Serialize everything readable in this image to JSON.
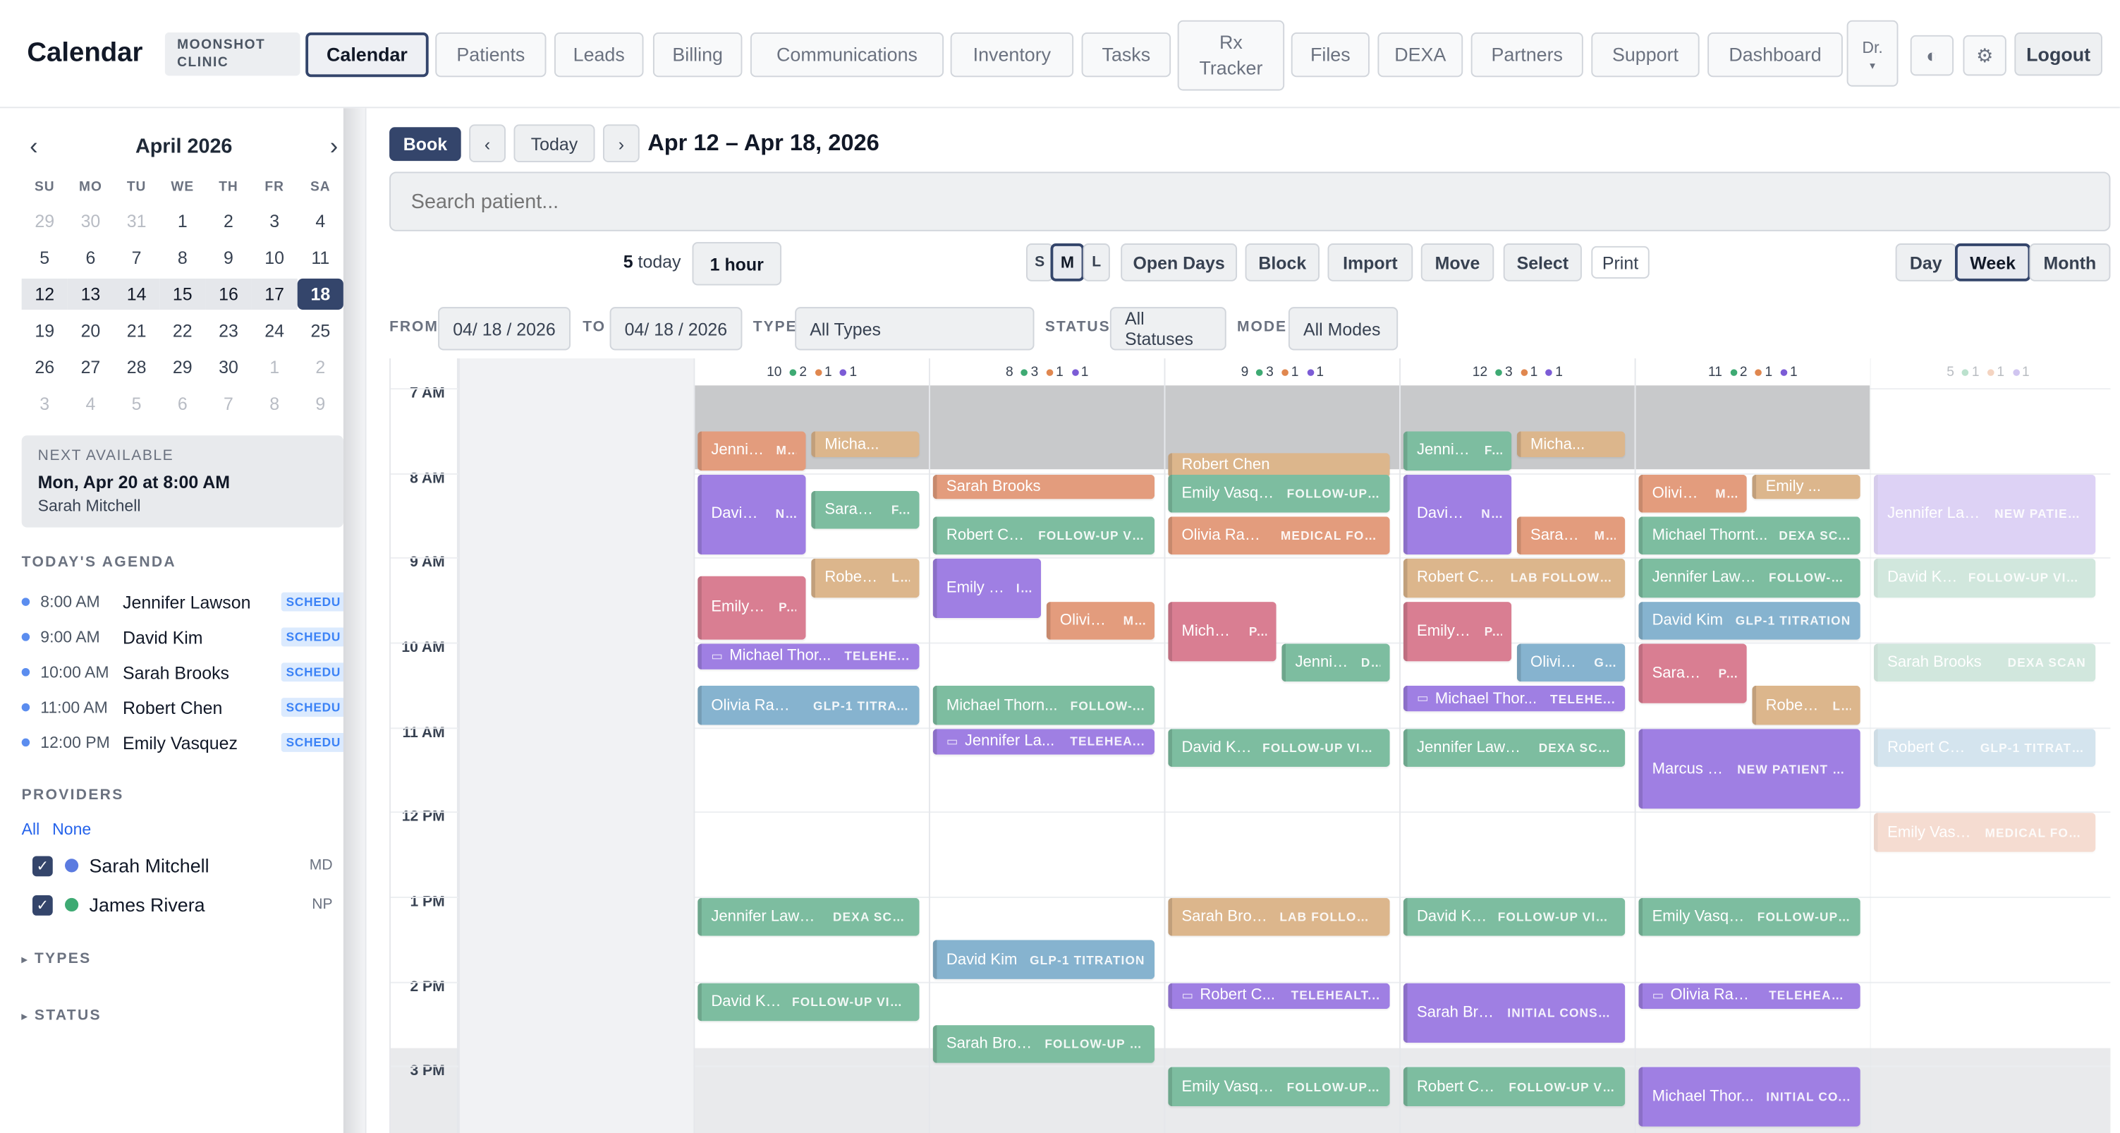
{
  "header": {
    "title": "Calendar",
    "clinic": "MOONSHOT CLINIC",
    "nav": [
      "Calendar",
      "Patients",
      "Leads",
      "Billing",
      "Communications",
      "Inventory",
      "Tasks",
      "Rx Tracker",
      "Files",
      "DEXA",
      "Partners",
      "Support",
      "Dashboard",
      "Dr."
    ],
    "logout": "Logout",
    "active_tab": "Calendar"
  },
  "mini_calendar": {
    "month_label": "April 2026",
    "prev": "‹",
    "next": "›",
    "dow": [
      "SU",
      "MO",
      "TU",
      "WE",
      "TH",
      "FR",
      "SA"
    ],
    "days": [
      "29",
      "30",
      "31",
      "1",
      "2",
      "3",
      "4",
      "5",
      "6",
      "7",
      "8",
      "9",
      "10",
      "11",
      "12",
      "13",
      "14",
      "15",
      "16",
      "17",
      "18",
      "19",
      "20",
      "21",
      "22",
      "23",
      "24",
      "25",
      "26",
      "27",
      "28",
      "29",
      "30",
      "1",
      "2",
      "3",
      "4",
      "5",
      "6",
      "7",
      "8",
      "9"
    ],
    "selected": "18"
  },
  "next_available": {
    "label": "NEXT AVAILABLE",
    "when": "Mon, Apr 20 at 8:00 AM",
    "provider": "Sarah Mitchell"
  },
  "agenda": {
    "label": "TODAY'S AGENDA",
    "items": [
      {
        "time": "8:00 AM",
        "name": "Jennifer Lawson",
        "status": "SCHEDU"
      },
      {
        "time": "9:00 AM",
        "name": "David Kim",
        "status": "SCHEDU"
      },
      {
        "time": "10:00 AM",
        "name": "Sarah Brooks",
        "status": "SCHEDU"
      },
      {
        "time": "11:00 AM",
        "name": "Robert Chen",
        "status": "SCHEDU"
      },
      {
        "time": "12:00 PM",
        "name": "Emily Vasquez",
        "status": "SCHEDU"
      }
    ]
  },
  "providers": {
    "label": "PROVIDERS",
    "all": "All",
    "none": "None",
    "items": [
      {
        "name": "Sarah Mitchell",
        "cred": "MD",
        "color": "#5b7be0"
      },
      {
        "name": "James Rivera",
        "cred": "NP",
        "color": "#3eaa73"
      }
    ]
  },
  "collapsibles": {
    "types": "TYPES",
    "status": "STATUS",
    "caret": "▸"
  },
  "toolbar": {
    "book": "Book",
    "prev": "‹",
    "today": "Today",
    "next": "›",
    "range": "Apr 12 – Apr 18, 2026",
    "search_placeholder": "Search patient...",
    "today_count": "5",
    "today_suffix": " today",
    "slot": "1 hour",
    "sizes": [
      "S",
      "M",
      "L"
    ],
    "actions": [
      "Open Days",
      "Block",
      "Import",
      "Move",
      "Select"
    ],
    "print": "Print",
    "views": [
      "Day",
      "Week",
      "Month"
    ],
    "active_view": "Week"
  },
  "filters": {
    "from_label": "FROM",
    "from": "04/ 18 / 2026",
    "to_label": "TO",
    "to": "04/ 18 / 2026",
    "type_label": "TYPE",
    "type": "All Types",
    "status_label": "STATUS",
    "status": "All Statuses",
    "mode_label": "MODE",
    "mode": "All Modes"
  },
  "colors": {
    "green": "#7dbda0",
    "blue": "#86b3cf",
    "orange": "#e39c7d",
    "purple": "#9f7fe3",
    "tan": "#dcb68c",
    "pink": "#d97e92",
    "primary": "#34456b"
  },
  "hours": [
    "7 AM",
    "8 AM",
    "9 AM",
    "10 AM",
    "11 AM",
    "12 PM",
    "1 PM",
    "2 PM",
    "3 PM"
  ],
  "columns": [
    {
      "counts": [
        "10",
        "2",
        "1",
        "1"
      ]
    },
    {
      "counts": [
        "8",
        "3",
        "1",
        "1"
      ]
    },
    {
      "counts": [
        "9",
        "3",
        "1",
        "1"
      ]
    },
    {
      "counts": [
        "12",
        "3",
        "1",
        "1"
      ]
    },
    {
      "counts": [
        "11",
        "2",
        "1",
        "1"
      ]
    },
    {
      "counts": [
        "5",
        "1",
        "1",
        "1"
      ]
    }
  ],
  "events": [
    {
      "day": 0,
      "start": 7.5,
      "dur": 0.5,
      "lane": 0,
      "lanes": 2,
      "name": "Jennife...",
      "type": "M...",
      "color": "orange"
    },
    {
      "day": 0,
      "start": 7.5,
      "dur": 0.35,
      "lane": 1,
      "lanes": 2,
      "name": "Micha...",
      "type": "",
      "color": "tan"
    },
    {
      "day": 0,
      "start": 8.0,
      "dur": 1.0,
      "lane": 0,
      "lanes": 2,
      "name": "David ...",
      "type": "N...",
      "color": "purple"
    },
    {
      "day": 0,
      "start": 8.2,
      "dur": 0.5,
      "lane": 1,
      "lanes": 2,
      "name": "Sarah ...",
      "type": "F...",
      "color": "green"
    },
    {
      "day": 0,
      "start": 9.0,
      "dur": 0.5,
      "lane": 1,
      "lanes": 2,
      "name": "Robert ...",
      "type": "L...",
      "color": "tan"
    },
    {
      "day": 0,
      "start": 9.2,
      "dur": 0.8,
      "lane": 0,
      "lanes": 2,
      "name": "Emily V...",
      "type": "P...",
      "color": "pink"
    },
    {
      "day": 0,
      "start": 10.0,
      "dur": 0.35,
      "lane": 0,
      "lanes": 1,
      "name": "Michael Thor...",
      "type": "TELEHE...",
      "color": "purple",
      "tele": true
    },
    {
      "day": 0,
      "start": 10.5,
      "dur": 0.5,
      "lane": 0,
      "lanes": 1,
      "name": "Olivia Ramir...",
      "type": "GLP-1 TITRAT...",
      "color": "blue"
    },
    {
      "day": 0,
      "start": 13.0,
      "dur": 0.5,
      "lane": 0,
      "lanes": 1,
      "name": "Jennifer Lawson",
      "type": "DEXA SCAN",
      "color": "green"
    },
    {
      "day": 0,
      "start": 14.0,
      "dur": 0.5,
      "lane": 0,
      "lanes": 1,
      "name": "David Kim",
      "type": "FOLLOW-UP VISIT",
      "color": "green"
    },
    {
      "day": 1,
      "start": 8.0,
      "dur": 0.3,
      "lane": 0,
      "lanes": 1,
      "name": "Sarah Brooks",
      "type": "",
      "color": "orange"
    },
    {
      "day": 1,
      "start": 8.5,
      "dur": 0.5,
      "lane": 0,
      "lanes": 1,
      "name": "Robert Ch...",
      "type": "FOLLOW-UP VI...",
      "color": "green"
    },
    {
      "day": 1,
      "start": 9.0,
      "dur": 0.75,
      "lane": 0,
      "lanes": 2,
      "name": "Emily V...",
      "type": "I...",
      "color": "purple"
    },
    {
      "day": 1,
      "start": 9.5,
      "dur": 0.5,
      "lane": 1,
      "lanes": 2,
      "name": "Olivia ...",
      "type": "M...",
      "color": "orange"
    },
    {
      "day": 1,
      "start": 10.5,
      "dur": 0.5,
      "lane": 0,
      "lanes": 1,
      "name": "Michael Thorn...",
      "type": "FOLLOW-...",
      "color": "green"
    },
    {
      "day": 1,
      "start": 11.0,
      "dur": 0.35,
      "lane": 0,
      "lanes": 1,
      "name": "Jennifer La...",
      "type": "TELEHEA...",
      "color": "purple",
      "tele": true
    },
    {
      "day": 1,
      "start": 13.5,
      "dur": 0.5,
      "lane": 0,
      "lanes": 1,
      "name": "David Kim",
      "type": "GLP-1 TITRATION",
      "color": "blue"
    },
    {
      "day": 1,
      "start": 14.5,
      "dur": 0.5,
      "lane": 0,
      "lanes": 1,
      "name": "Sarah Broo...",
      "type": "FOLLOW-UP V...",
      "color": "green"
    },
    {
      "day": 2,
      "start": 7.75,
      "dur": 0.25,
      "lane": 0,
      "lanes": 1,
      "name": "Robert Chen",
      "type": "",
      "color": "tan"
    },
    {
      "day": 2,
      "start": 8.0,
      "dur": 0.5,
      "lane": 0,
      "lanes": 1,
      "name": "Emily Vasqu...",
      "type": "FOLLOW-UP ...",
      "color": "green"
    },
    {
      "day": 2,
      "start": 8.5,
      "dur": 0.5,
      "lane": 0,
      "lanes": 1,
      "name": "Olivia Rami...",
      "type": "MEDICAL FOL...",
      "color": "orange"
    },
    {
      "day": 2,
      "start": 9.5,
      "dur": 0.75,
      "lane": 0,
      "lanes": 2,
      "name": "Michae...",
      "type": "P...",
      "color": "pink"
    },
    {
      "day": 2,
      "start": 10.0,
      "dur": 0.5,
      "lane": 1,
      "lanes": 2,
      "name": "Jennife...",
      "type": "D...",
      "color": "green"
    },
    {
      "day": 2,
      "start": 11.0,
      "dur": 0.5,
      "lane": 0,
      "lanes": 1,
      "name": "David Kim",
      "type": "FOLLOW-UP VISIT",
      "color": "green"
    },
    {
      "day": 2,
      "start": 13.0,
      "dur": 0.5,
      "lane": 0,
      "lanes": 1,
      "name": "Sarah Broo...",
      "type": "LAB FOLLOW ...",
      "color": "tan"
    },
    {
      "day": 2,
      "start": 14.0,
      "dur": 0.35,
      "lane": 0,
      "lanes": 1,
      "name": "Robert C...",
      "type": "TELEHEALT...",
      "color": "purple",
      "tele": true
    },
    {
      "day": 2,
      "start": 15.0,
      "dur": 0.5,
      "lane": 0,
      "lanes": 1,
      "name": "Emily Vasqu...",
      "type": "FOLLOW-UP ...",
      "color": "green"
    },
    {
      "day": 3,
      "start": 7.5,
      "dur": 0.5,
      "lane": 0,
      "lanes": 2,
      "name": "Jennife...",
      "type": "F...",
      "color": "green"
    },
    {
      "day": 3,
      "start": 7.5,
      "dur": 0.35,
      "lane": 1,
      "lanes": 2,
      "name": "Micha...",
      "type": "",
      "color": "tan"
    },
    {
      "day": 3,
      "start": 8.0,
      "dur": 1.0,
      "lane": 0,
      "lanes": 2,
      "name": "David ...",
      "type": "N...",
      "color": "purple"
    },
    {
      "day": 3,
      "start": 8.5,
      "dur": 0.5,
      "lane": 1,
      "lanes": 2,
      "name": "Sarah ...",
      "type": "M...",
      "color": "orange"
    },
    {
      "day": 3,
      "start": 9.0,
      "dur": 0.5,
      "lane": 0,
      "lanes": 1,
      "name": "Robert Chen",
      "type": "LAB FOLLOW UP",
      "color": "tan"
    },
    {
      "day": 3,
      "start": 9.5,
      "dur": 0.75,
      "lane": 0,
      "lanes": 2,
      "name": "Emily V...",
      "type": "P...",
      "color": "pink"
    },
    {
      "day": 3,
      "start": 10.0,
      "dur": 0.5,
      "lane": 1,
      "lanes": 2,
      "name": "Olivia ...",
      "type": "G...",
      "color": "blue"
    },
    {
      "day": 3,
      "start": 10.5,
      "dur": 0.35,
      "lane": 0,
      "lanes": 1,
      "name": "Michael Thor...",
      "type": "TELEHE...",
      "color": "purple",
      "tele": true
    },
    {
      "day": 3,
      "start": 11.0,
      "dur": 0.5,
      "lane": 0,
      "lanes": 1,
      "name": "Jennifer Lawson",
      "type": "DEXA SCAN",
      "color": "green"
    },
    {
      "day": 3,
      "start": 13.0,
      "dur": 0.5,
      "lane": 0,
      "lanes": 1,
      "name": "David Kim",
      "type": "FOLLOW-UP VISIT",
      "color": "green"
    },
    {
      "day": 3,
      "start": 14.0,
      "dur": 0.75,
      "lane": 0,
      "lanes": 1,
      "name": "Sarah Bro...",
      "type": "INITIAL CONSU...",
      "color": "purple"
    },
    {
      "day": 3,
      "start": 15.0,
      "dur": 0.5,
      "lane": 0,
      "lanes": 1,
      "name": "Robert Ch...",
      "type": "FOLLOW-UP VI...",
      "color": "green"
    },
    {
      "day": 4,
      "start": 8.0,
      "dur": 0.5,
      "lane": 0,
      "lanes": 2,
      "name": "Olivia ...",
      "type": "M...",
      "color": "orange"
    },
    {
      "day": 4,
      "start": 8.0,
      "dur": 0.3,
      "lane": 1,
      "lanes": 2,
      "name": "Emily ...",
      "type": "",
      "color": "tan"
    },
    {
      "day": 4,
      "start": 8.5,
      "dur": 0.5,
      "lane": 0,
      "lanes": 1,
      "name": "Michael Thornt...",
      "type": "DEXA SC...",
      "color": "green"
    },
    {
      "day": 4,
      "start": 9.0,
      "dur": 0.5,
      "lane": 0,
      "lanes": 1,
      "name": "Jennifer Laws...",
      "type": "FOLLOW-U...",
      "color": "green"
    },
    {
      "day": 4,
      "start": 9.5,
      "dur": 0.5,
      "lane": 0,
      "lanes": 1,
      "name": "David Kim",
      "type": "GLP-1 TITRATION",
      "color": "blue"
    },
    {
      "day": 4,
      "start": 10.0,
      "dur": 0.75,
      "lane": 0,
      "lanes": 2,
      "name": "Sarah ...",
      "type": "P...",
      "color": "pink"
    },
    {
      "day": 4,
      "start": 10.5,
      "dur": 0.5,
      "lane": 1,
      "lanes": 2,
      "name": "Robert ...",
      "type": "L...",
      "color": "tan"
    },
    {
      "day": 4,
      "start": 11.0,
      "dur": 1.0,
      "lane": 0,
      "lanes": 1,
      "name": "Marcus P...",
      "type": "NEW PATIENT C...",
      "color": "purple"
    },
    {
      "day": 4,
      "start": 13.0,
      "dur": 0.5,
      "lane": 0,
      "lanes": 1,
      "name": "Emily Vasqu...",
      "type": "FOLLOW-UP ...",
      "color": "green"
    },
    {
      "day": 4,
      "start": 14.0,
      "dur": 0.35,
      "lane": 0,
      "lanes": 1,
      "name": "Olivia Ram...",
      "type": "TELEHEAL...",
      "color": "purple",
      "tele": true
    },
    {
      "day": 4,
      "start": 15.0,
      "dur": 0.75,
      "lane": 0,
      "lanes": 1,
      "name": "Michael Thor...",
      "type": "INITIAL CO...",
      "color": "purple"
    },
    {
      "day": 5,
      "start": 8.0,
      "dur": 1.0,
      "lane": 0,
      "lanes": 1,
      "name": "Jennifer Law...",
      "type": "NEW PATIEN...",
      "color": "purple"
    },
    {
      "day": 5,
      "start": 9.0,
      "dur": 0.5,
      "lane": 0,
      "lanes": 1,
      "name": "David Kim",
      "type": "FOLLOW-UP VISIT",
      "color": "green"
    },
    {
      "day": 5,
      "start": 10.0,
      "dur": 0.5,
      "lane": 0,
      "lanes": 1,
      "name": "Sarah Brooks",
      "type": "DEXA SCAN",
      "color": "green"
    },
    {
      "day": 5,
      "start": 11.0,
      "dur": 0.5,
      "lane": 0,
      "lanes": 1,
      "name": "Robert Ch...",
      "type": "GLP-1 TITRATI...",
      "color": "blue"
    },
    {
      "day": 5,
      "start": 12.0,
      "dur": 0.5,
      "lane": 0,
      "lanes": 1,
      "name": "Emily Vasq...",
      "type": "MEDICAL FOL...",
      "color": "orange"
    }
  ]
}
